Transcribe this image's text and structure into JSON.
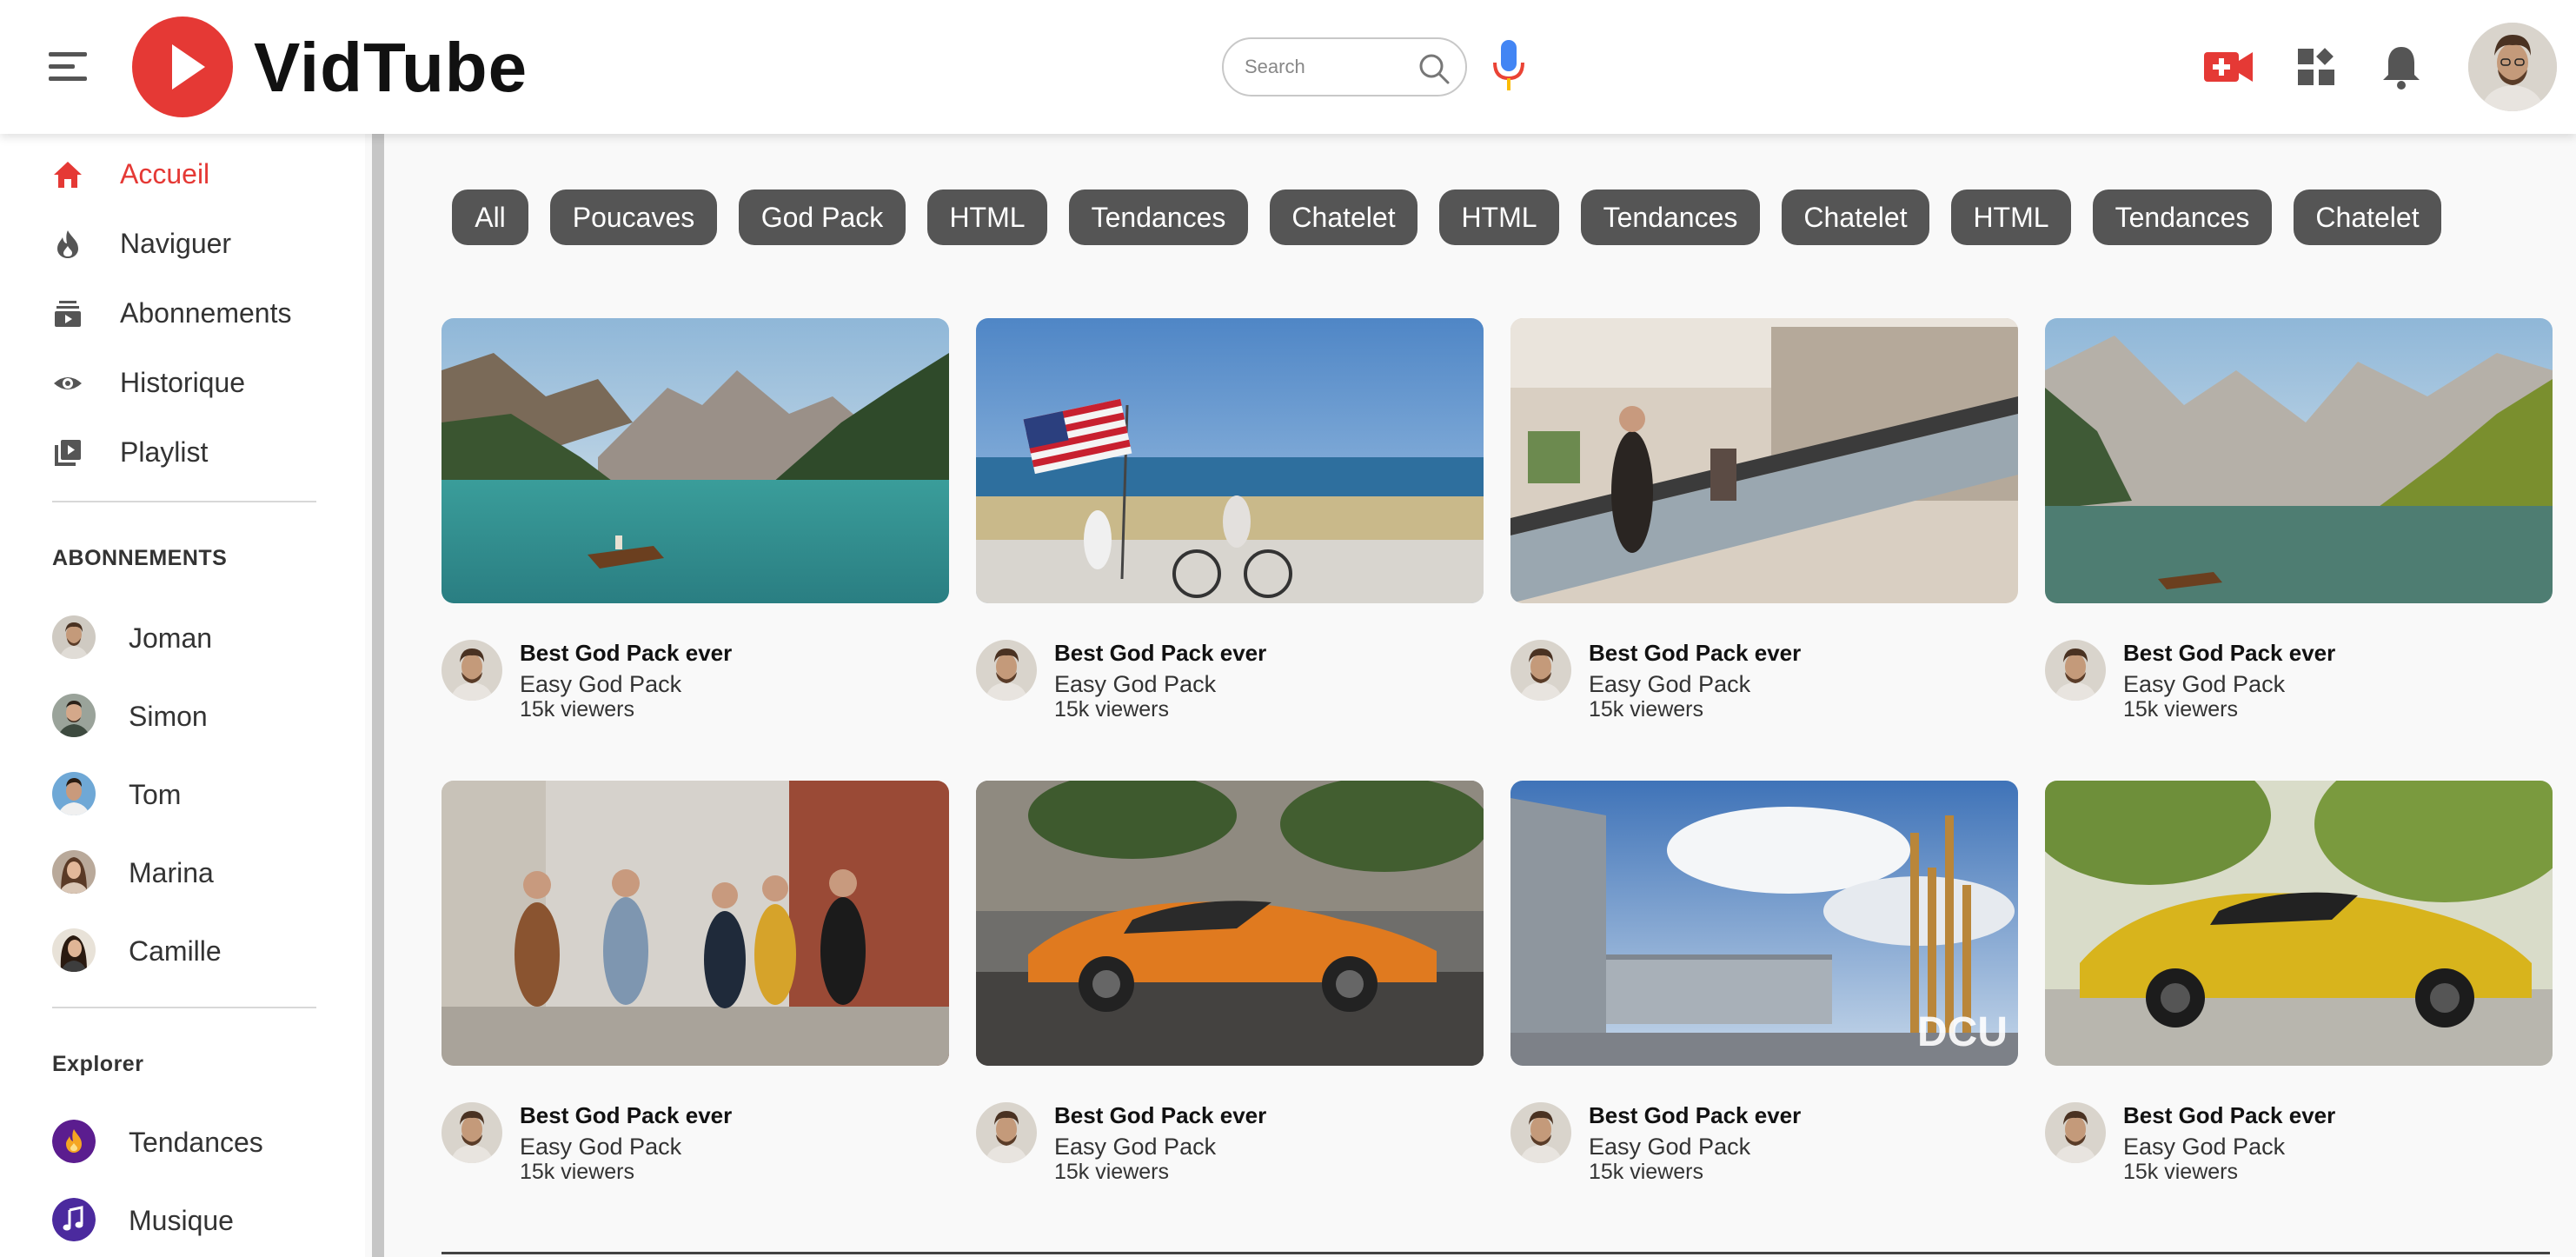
{
  "app": {
    "name": "VidTube"
  },
  "search": {
    "placeholder": "Search"
  },
  "sidebar": {
    "nav": [
      {
        "label": "Accueil",
        "icon": "home-icon",
        "active": true
      },
      {
        "label": "Naviguer",
        "icon": "fire-icon"
      },
      {
        "label": "Abonnements",
        "icon": "subscriptions-icon"
      },
      {
        "label": "Historique",
        "icon": "eye-icon"
      },
      {
        "label": "Playlist",
        "icon": "playlist-icon"
      }
    ],
    "subscriptions_title": "ABONNEMENTS",
    "subscriptions": [
      {
        "name": "Joman"
      },
      {
        "name": "Simon"
      },
      {
        "name": "Tom"
      },
      {
        "name": "Marina"
      },
      {
        "name": "Camille"
      }
    ],
    "explore_title": "Explorer",
    "explore": [
      {
        "label": "Tendances",
        "icon": "trending-icon"
      },
      {
        "label": "Musique",
        "icon": "music-icon"
      }
    ]
  },
  "chips": [
    "All",
    "Poucaves",
    "God Pack",
    "HTML",
    "Tendances",
    "Chatelet",
    "HTML",
    "Tendances",
    "Chatelet",
    "HTML",
    "Tendances",
    "Chatelet"
  ],
  "videos": [
    {
      "title": "Best God Pack ever",
      "channel": "Easy God Pack",
      "views": "15k viewers",
      "thumbnail": "mountain-lake-boat"
    },
    {
      "title": "Best God Pack ever",
      "channel": "Easy God Pack",
      "views": "15k viewers",
      "thumbnail": "flag-bike-beach"
    },
    {
      "title": "Best God Pack ever",
      "channel": "Easy God Pack",
      "views": "15k viewers",
      "thumbnail": "mall-escalator"
    },
    {
      "title": "Best God Pack ever",
      "channel": "Easy God Pack",
      "views": "15k viewers",
      "thumbnail": "mountain-lake-forest"
    },
    {
      "title": "Best God Pack ever",
      "channel": "Easy God Pack",
      "views": "15k viewers",
      "thumbnail": "friends-walking"
    },
    {
      "title": "Best God Pack ever",
      "channel": "Easy God Pack",
      "views": "15k viewers",
      "thumbnail": "orange-sports-car"
    },
    {
      "title": "Best God Pack ever",
      "channel": "Easy God Pack",
      "views": "15k viewers",
      "thumbnail": "campus-building",
      "watermark": "DCU"
    },
    {
      "title": "Best God Pack ever",
      "channel": "Easy God Pack",
      "views": "15k viewers",
      "thumbnail": "yellow-sports-car"
    }
  ],
  "colors": {
    "accent": "#e53935",
    "chip_bg": "#555555",
    "mic_blue": "#4285f4"
  }
}
